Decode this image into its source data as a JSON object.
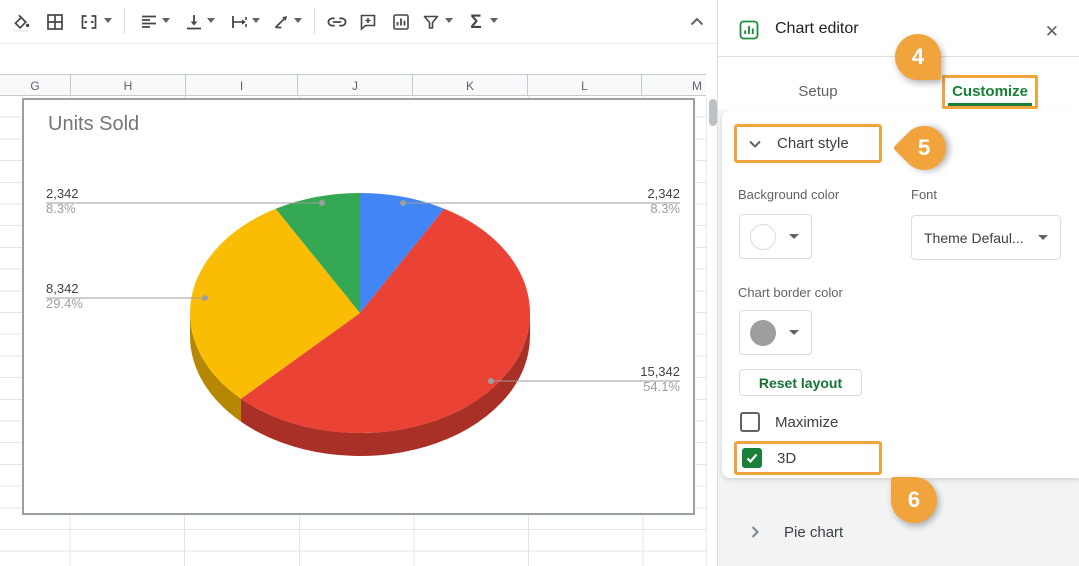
{
  "sheet": {
    "columns": [
      "G",
      "H",
      "I",
      "J",
      "K",
      "L",
      "M"
    ],
    "toolbar_icons": [
      "fill-color-icon",
      "borders-icon",
      "merge-cells-icon",
      "horizontal-align-icon",
      "vertical-align-icon",
      "text-wrap-icon",
      "text-rotation-icon",
      "insert-link-icon",
      "insert-comment-icon",
      "insert-chart-icon",
      "filter-icon",
      "functions-sigma-icon",
      "collapse-toolbar-icon"
    ],
    "sigma_glyph": "Σ"
  },
  "chart_data": {
    "type": "pie",
    "title": "Units Sold",
    "is_3d": true,
    "legend": "none",
    "slices": [
      {
        "name": "blue-slice",
        "value": 2342,
        "display": "2,342",
        "pct": "8.3%",
        "hex": "#4285F4"
      },
      {
        "name": "red-slice",
        "value": 15342,
        "display": "15,342",
        "pct": "54.1%",
        "hex": "#EA4335"
      },
      {
        "name": "yellow-slice",
        "value": 8342,
        "display": "8,342",
        "pct": "29.4%",
        "hex": "#FBBC04"
      },
      {
        "name": "green-slice",
        "value": 2342,
        "display": "2,342",
        "pct": "8.3%",
        "hex": "#34A853"
      }
    ]
  },
  "panel": {
    "title": "Chart editor",
    "close_glyph": "✕",
    "tabs": [
      {
        "label": "Setup",
        "active": false
      },
      {
        "label": "Customize",
        "active": true
      }
    ],
    "chart_style": {
      "section_label": "Chart style",
      "background_color_label": "Background color",
      "font_label": "Font",
      "font_value": "Theme Defaul...",
      "border_color_label": "Chart border color",
      "reset_button": "Reset layout",
      "maximize_label": "Maximize",
      "maximize_checked": false,
      "threed_label": "3D",
      "threed_checked": true
    },
    "pie_section_label": "Pie chart"
  },
  "annotations": {
    "badge4": "4",
    "badge5": "5",
    "badge6": "6",
    "highlight_color": "#f2a43c"
  },
  "colors": {
    "accent_green": "#188038",
    "label_value": "#424242",
    "label_pct": "#9e9e9e",
    "pie_side_red": "#b0271d",
    "pie_side_yellow": "#b58b00"
  }
}
